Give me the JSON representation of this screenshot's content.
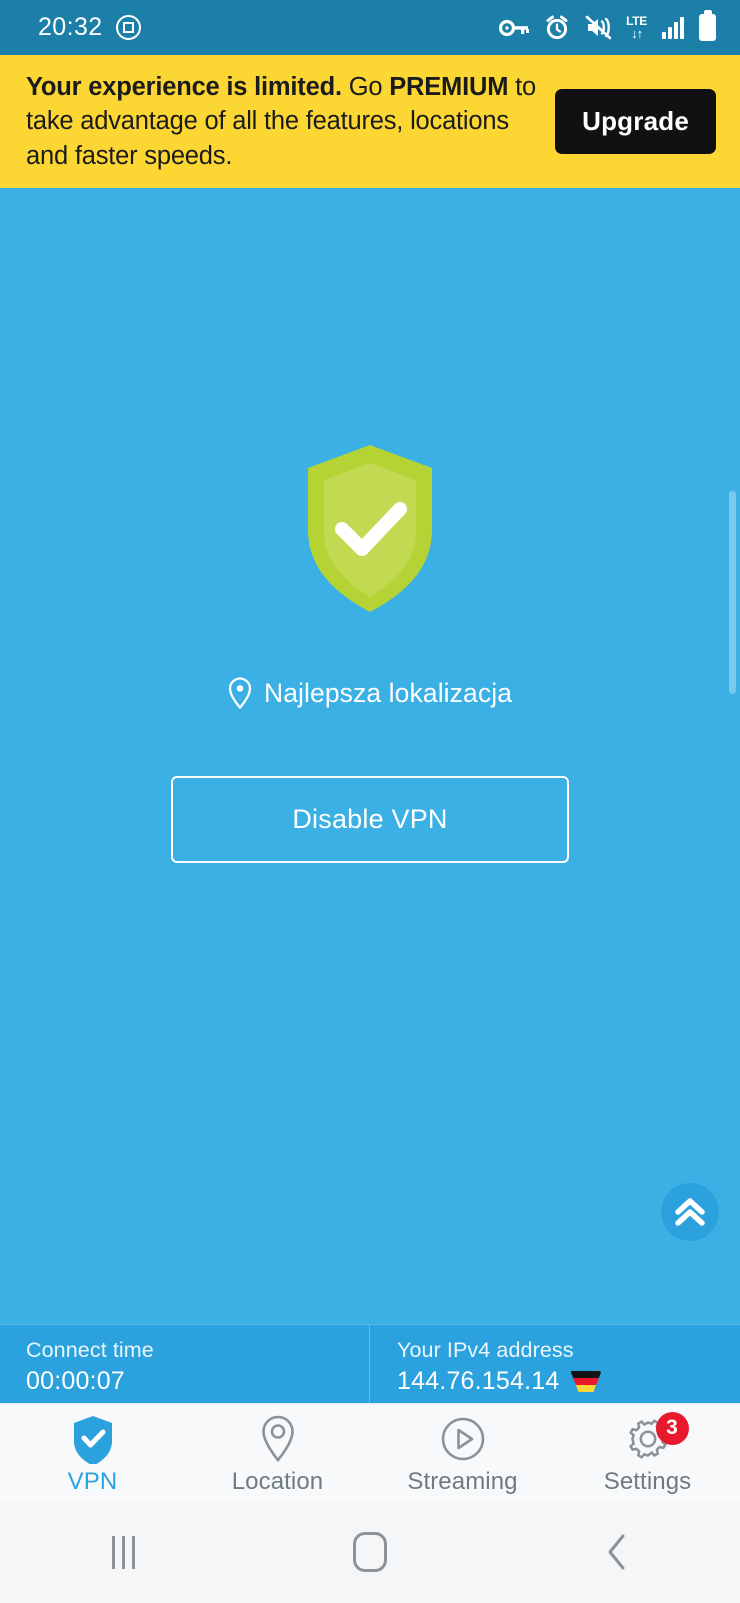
{
  "status_bar": {
    "time": "20:32",
    "icons": [
      "screenshot-app-icon",
      "vpn-key-icon",
      "alarm-icon",
      "mute-vibrate-icon",
      "lte-data-icon",
      "signal-bars-icon",
      "battery-icon"
    ],
    "lte_label": "LTE",
    "background": "#1b7fa8"
  },
  "banner": {
    "text_bold_1": "Your experience is limited.",
    "text_plain_1": " Go ",
    "text_bold_2": "PREMIUM",
    "text_plain_2": " to take advantage of all the features, locations and faster speeds.",
    "upgrade_label": "Upgrade",
    "background": "#fcd633",
    "button_background": "#111111"
  },
  "main": {
    "shield_status": "connected",
    "shield_color": "#b5d334",
    "shield_inner_color": "#c2da52",
    "check_color": "#ffffff",
    "location_label": "Najlepsza lokalizacja",
    "location_icon": "map-pin-icon",
    "disable_label": "Disable VPN",
    "expand_icon": "double-chevron-up-icon",
    "background": "#3bb0e5"
  },
  "info_bar": {
    "connect_time_label": "Connect time",
    "connect_time_value": "00:00:07",
    "ip_label": "Your IPv4 address",
    "ip_value": "144.76.154.14",
    "flag": "germany-flag-icon",
    "background": "#2ba2dd"
  },
  "tabs": [
    {
      "label": "VPN",
      "icon": "shield-check-icon",
      "active": true,
      "badge": ""
    },
    {
      "label": "Location",
      "icon": "map-pin-icon",
      "active": false,
      "badge": ""
    },
    {
      "label": "Streaming",
      "icon": "play-circle-icon",
      "active": false,
      "badge": ""
    },
    {
      "label": "Settings",
      "icon": "gear-icon",
      "active": false,
      "badge": "3"
    }
  ],
  "tab_accent": "#2ba2dd",
  "badge_color": "#e8192c",
  "android_nav": {
    "recent_icon": "recent-apps-icon",
    "home_icon": "home-icon",
    "back_icon": "back-icon"
  }
}
